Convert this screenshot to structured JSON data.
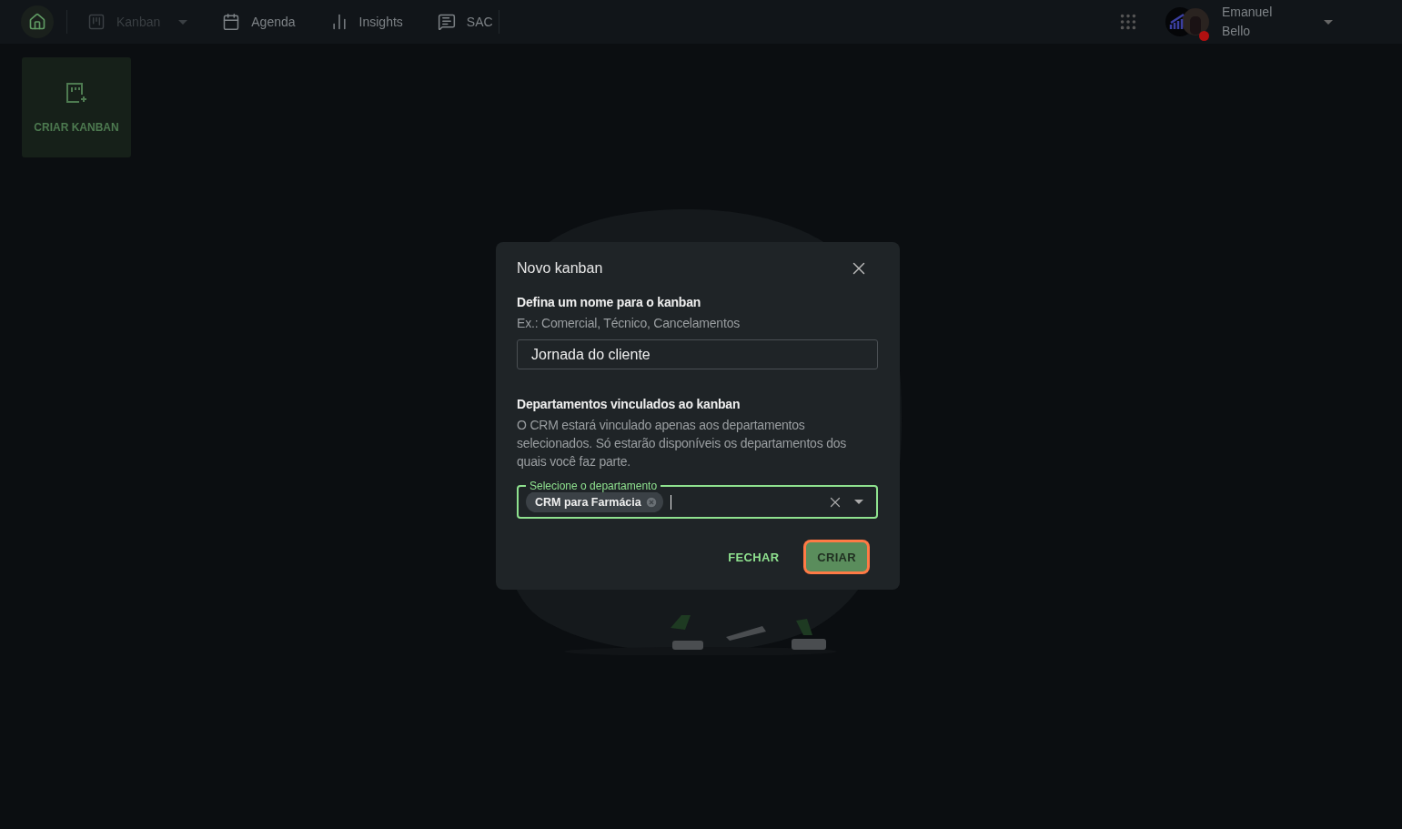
{
  "nav": {
    "home": {
      "selected": true
    },
    "items": [
      {
        "label": "Kanban",
        "disabled": true,
        "dropdown": true
      },
      {
        "label": "Agenda",
        "disabled": false,
        "dropdown": false
      },
      {
        "label": "Insights",
        "disabled": false,
        "dropdown": false
      },
      {
        "label": "SAC",
        "disabled": false,
        "dropdown": false
      }
    ]
  },
  "user": {
    "first_name": "Emanuel",
    "last_name": "Bello"
  },
  "create_card": {
    "label": "CRIAR KANBAN"
  },
  "dialog": {
    "title": "Novo kanban",
    "name_section": {
      "label": "Defina um nome para o kanban",
      "hint": "Ex.: Comercial, Técnico, Cancelamentos",
      "value": "Jornada do cliente"
    },
    "departments_section": {
      "label": "Departamentos vinculados ao kanban",
      "description": "O CRM estará vinculado apenas aos departamentos selecionados. Só estarão disponíveis os departamentos dos quais você faz parte.",
      "select": {
        "label": "Selecione o departamento",
        "focused": true,
        "chips": [
          {
            "label": "CRM para Farmácia"
          }
        ]
      }
    },
    "buttons": [
      {
        "label": "FECHAR",
        "kind": "text",
        "focused": false
      },
      {
        "label": "CRIAR",
        "kind": "contained",
        "focused": true
      }
    ]
  }
}
